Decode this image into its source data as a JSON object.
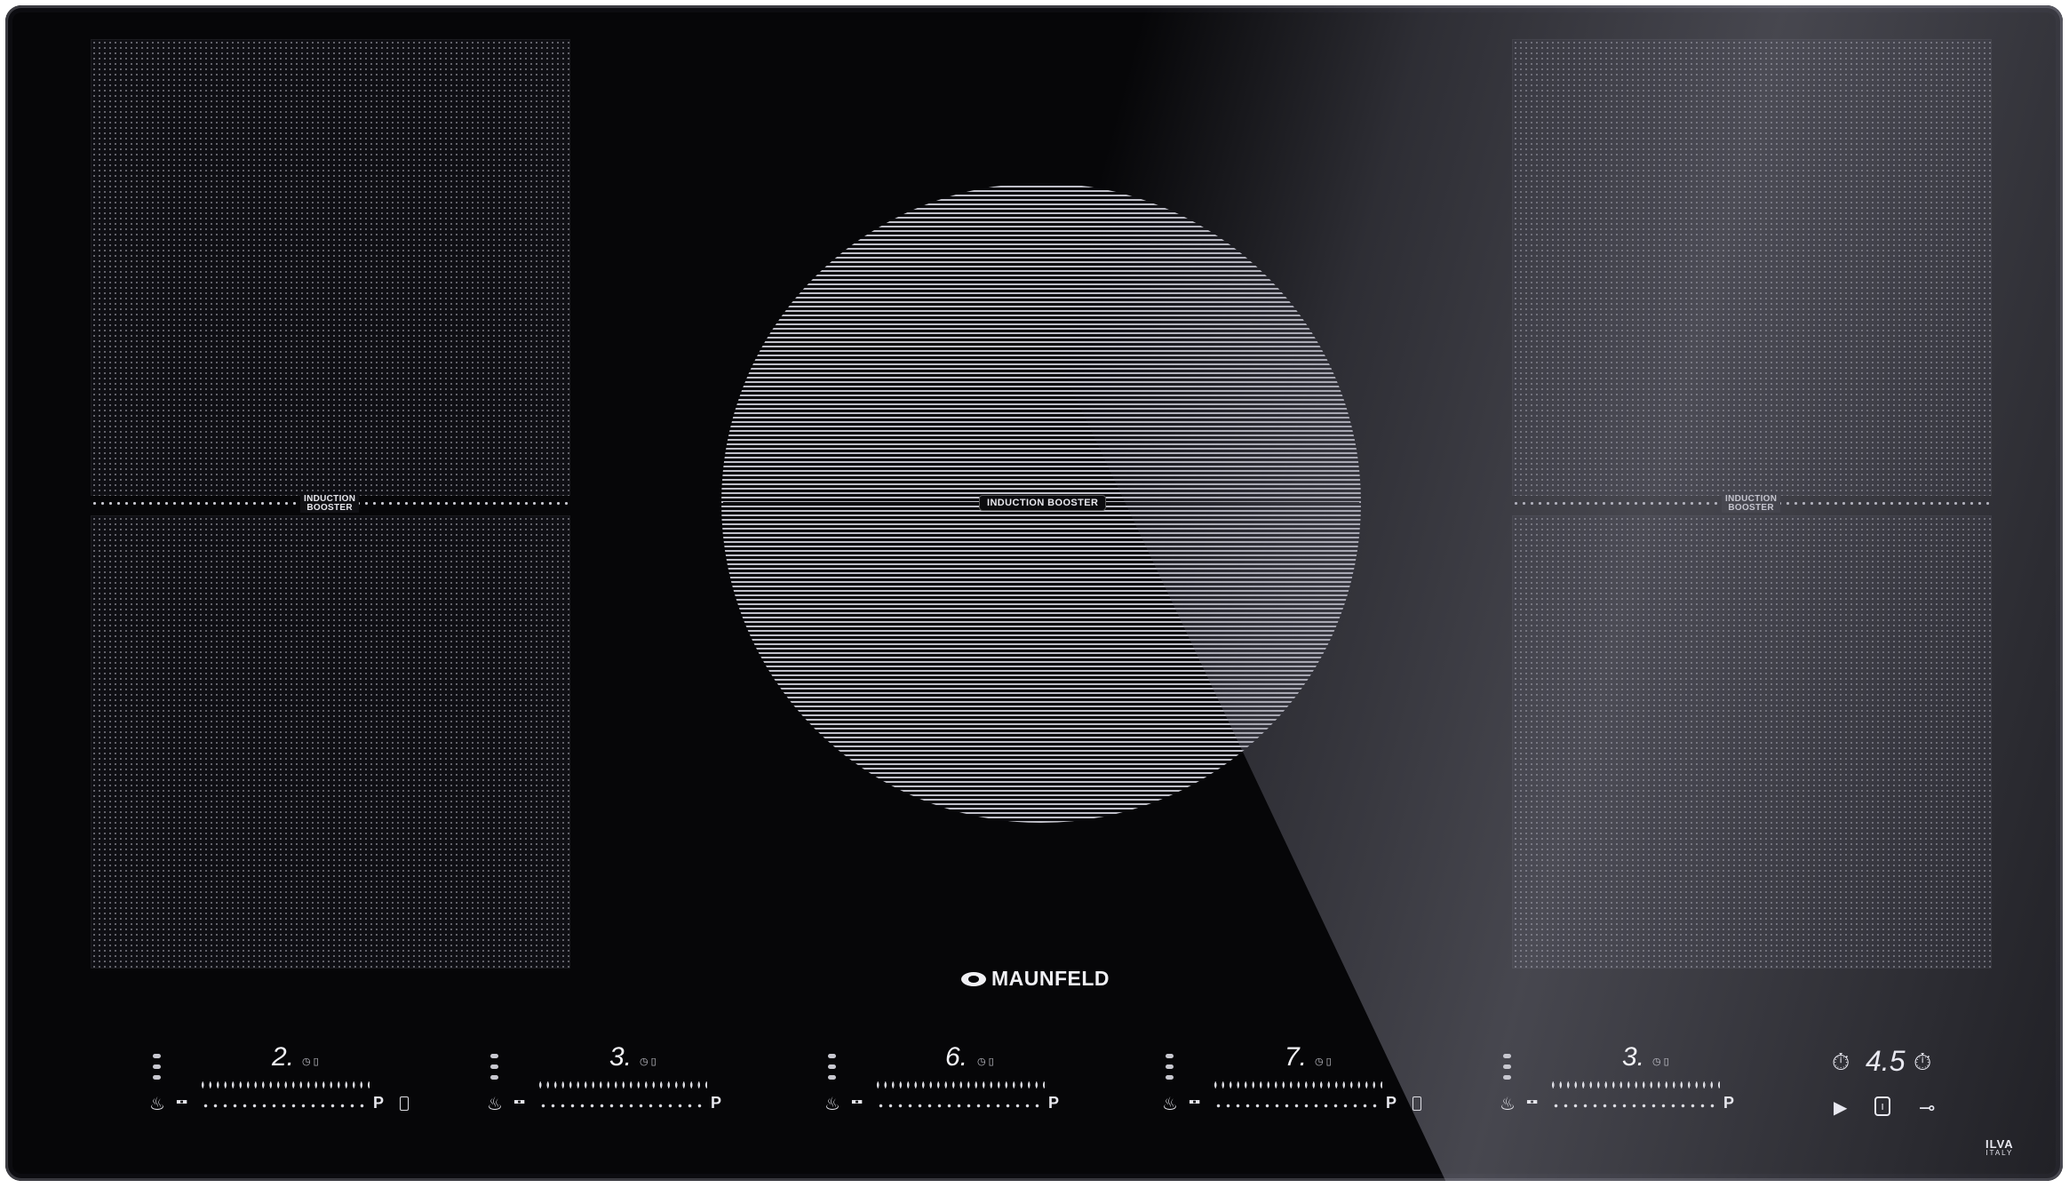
{
  "brand": {
    "name": "MAUNFELD",
    "logo_icon": "maunfeld-logo-icon"
  },
  "zones": {
    "left_booster_label": "INDUCTION\nBOOSTER",
    "right_booster_label": "INDUCTION\nBOOSTER",
    "center_booster_label": "INDUCTION  BOOSTER"
  },
  "controls": [
    {
      "display": "2.",
      "p_label": "P",
      "has_lock": true
    },
    {
      "display": "3.",
      "p_label": "P",
      "has_lock": false
    },
    {
      "display": "6.",
      "p_label": "P",
      "has_lock": false
    },
    {
      "display": "7.",
      "p_label": "P",
      "has_lock": true
    },
    {
      "display": "3.",
      "p_label": "P",
      "has_lock": false
    }
  ],
  "timer": {
    "value": "4.5",
    "minus_icon": "timer-minus-icon",
    "plus_icon": "timer-plus-icon"
  },
  "bottom_right": {
    "play_icon": "play-icon",
    "power_icon": "power-icon",
    "key_icon": "key-lock-icon"
  },
  "maker": {
    "name": "ILVA",
    "country": "ITALY"
  },
  "colors": {
    "glass": "#060608",
    "print": "#e8e8f0"
  }
}
